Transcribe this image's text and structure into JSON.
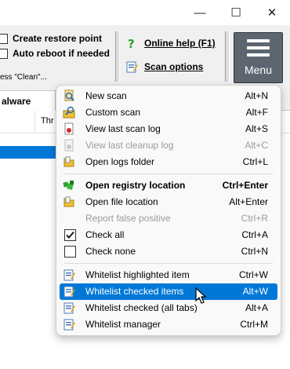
{
  "window": {
    "minimize_glyph": "—",
    "maximize_glyph": "☐",
    "close_glyph": "✕"
  },
  "options": {
    "create_restore_point": "Create restore point",
    "auto_reboot": "Auto reboot if needed"
  },
  "links": {
    "online_help": "Online help (F1)",
    "scan_options": "Scan options"
  },
  "menu_button": {
    "label": "Menu"
  },
  "status_text": "ess \"Clean\"...",
  "tabs": {
    "active_label": "alware"
  },
  "columns": {
    "col_label": "Thr"
  },
  "context_menu": {
    "items": [
      {
        "label": "New scan",
        "shortcut": "Alt+N",
        "icon": "magnifier-scan-icon",
        "disabled": false,
        "bold": false
      },
      {
        "label": "Custom scan",
        "shortcut": "Alt+F",
        "icon": "custom-scan-icon",
        "disabled": false,
        "bold": false
      },
      {
        "label": "View last scan log",
        "shortcut": "Alt+S",
        "icon": "scan-log-icon",
        "disabled": false,
        "bold": false
      },
      {
        "label": "View last cleanup log",
        "shortcut": "Alt+C",
        "icon": "cleanup-log-icon",
        "disabled": true,
        "bold": false
      },
      {
        "label": "Open logs folder",
        "shortcut": "Ctrl+L",
        "icon": "folder-icon",
        "disabled": false,
        "bold": false
      },
      {
        "label": "Open registry location",
        "shortcut": "Ctrl+Enter",
        "icon": "registry-icon",
        "disabled": false,
        "bold": true
      },
      {
        "label": "Open file location",
        "shortcut": "Alt+Enter",
        "icon": "file-location-icon",
        "disabled": false,
        "bold": false
      },
      {
        "label": "Report false positive",
        "shortcut": "Ctrl+R",
        "icon": "",
        "disabled": true,
        "bold": false
      },
      {
        "label": "Check all",
        "shortcut": "Ctrl+A",
        "icon": "checked-box-icon",
        "disabled": false,
        "bold": false
      },
      {
        "label": "Check none",
        "shortcut": "Ctrl+N",
        "icon": "unchecked-box-icon",
        "disabled": false,
        "bold": false
      },
      {
        "label": "Whitelist highlighted item",
        "shortcut": "Ctrl+W",
        "icon": "whitelist-icon",
        "disabled": false,
        "bold": false
      },
      {
        "label": "Whitelist checked items",
        "shortcut": "Alt+W",
        "icon": "whitelist-icon",
        "disabled": false,
        "bold": false,
        "highlighted": true
      },
      {
        "label": "Whitelist checked (all tabs)",
        "shortcut": "Alt+A",
        "icon": "whitelist-icon",
        "disabled": false,
        "bold": false
      },
      {
        "label": "Whitelist manager",
        "shortcut": "Ctrl+M",
        "icon": "whitelist-icon",
        "disabled": false,
        "bold": false
      }
    ]
  }
}
